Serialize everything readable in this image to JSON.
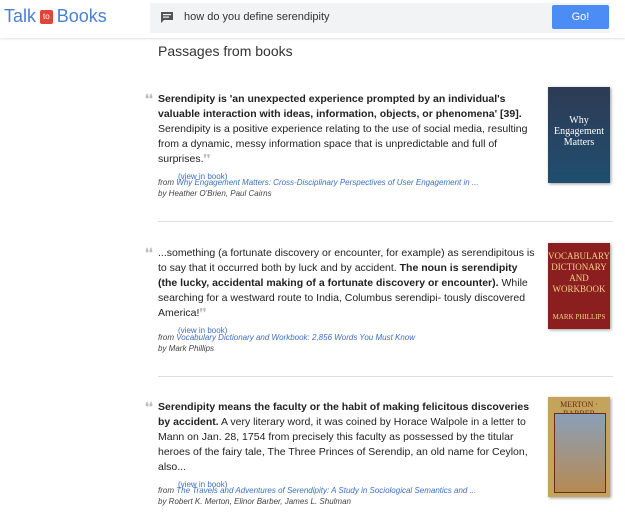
{
  "header": {
    "logo_talk": "Talk",
    "logo_to": "to",
    "logo_books": "Books",
    "query": "how do you define serendipity",
    "go_label": "Go!"
  },
  "section_title": "Passages from books",
  "view_link": "(view in book)",
  "from_label": "from",
  "results": [
    {
      "bold": "Serendipity is 'an unexpected experience prompted by an individual's valuable interaction with ideas, information, objects, or phenomena' [39].",
      "text": " Serendipity is a positive experience relating to the use of social media, resulting from a dynamic, messy information space that is unpredictable and full of surprises.",
      "book": "Why Engagement Matters: Cross-Disciplinary Perspectives of User Engagement in ...",
      "authors": "by Heather O'Brien, Paul Cairns",
      "cover_title": "Why Engagement Matters"
    },
    {
      "pre": "...something (a fortunate discovery or encounter, for example) as serendipitous is to say that it occurred both by luck and by accident. ",
      "bold": "The noun is serendipity (the lucky, accidental making of a fortunate discovery or encounter).",
      "text": " While searching for a westward route to India, Columbus serendipi- tously discovered America!",
      "book": "Vocabulary Dictionary and Workbook: 2,856 Words You Must Know",
      "authors": "by Mark Phillips",
      "cover_title": "VOCABULARY DICTIONARY AND WORKBOOK",
      "cover_author": "MARK PHILLIPS"
    },
    {
      "bold": "Serendipity means the faculty or the habit of making felicitous discoveries by accident.",
      "text": " A very literary word, it was coined by Horace Walpole in a letter to Mann on Jan. 28, 1754 from precisely this faculty as possessed by the titular heroes of the fairy tale, The Three Princes of Serendip, an old name for Ceylon, also...",
      "book": "The Travels and Adventures of Serendipity: A Study in Sociological Semantics and ...",
      "authors": "by Robert K. Merton, Elinor Barber, James L. Shulman",
      "cover_title": "MERTON · BARBER"
    }
  ]
}
